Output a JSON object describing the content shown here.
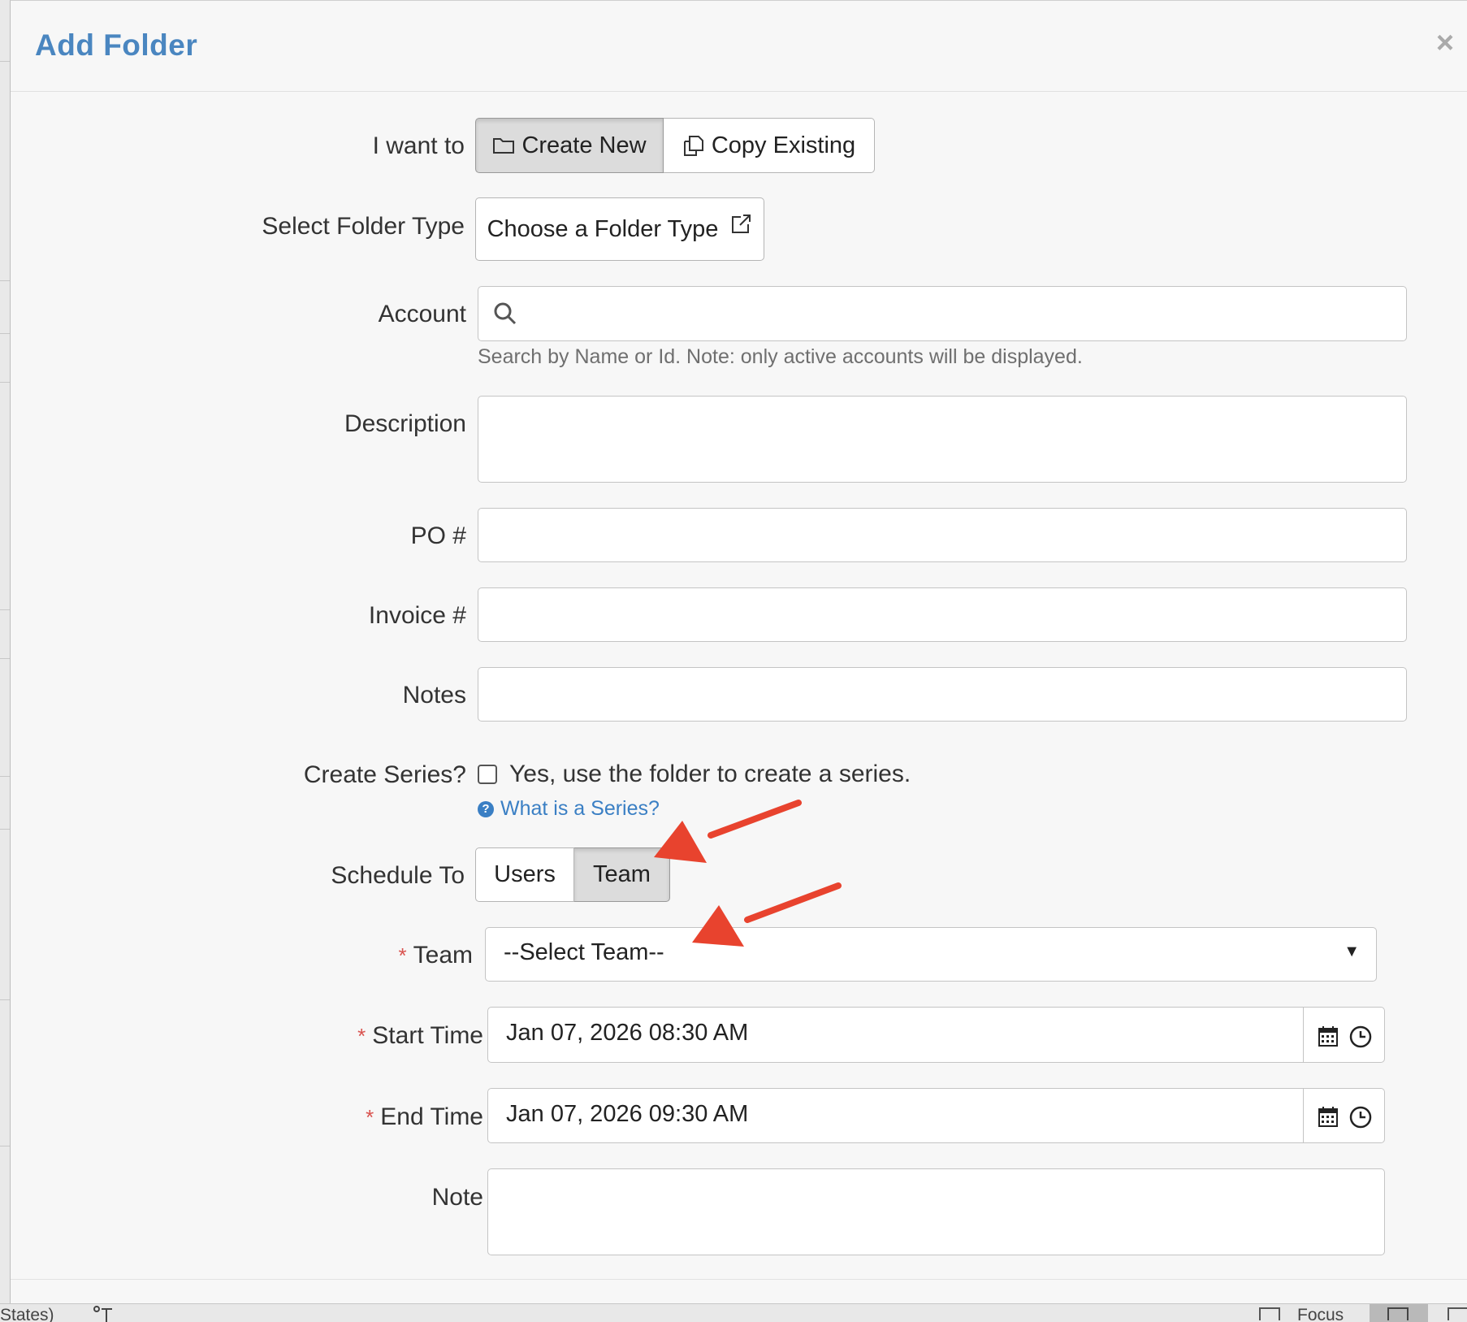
{
  "modal": {
    "title": "Add Folder",
    "close_symbol": "×"
  },
  "form": {
    "i_want_to": {
      "label": "I want to",
      "options": [
        {
          "label": "Create New",
          "icon": "folder-icon",
          "active": true
        },
        {
          "label": "Copy Existing",
          "icon": "copy-icon",
          "active": false
        }
      ]
    },
    "folder_type": {
      "label": "Select Folder Type",
      "button_label": "Choose a Folder Type",
      "icon": "external-link-icon"
    },
    "account": {
      "label": "Account",
      "value": "",
      "icon": "search-icon",
      "help": "Search by Name or Id. Note: only active accounts will be displayed."
    },
    "description": {
      "label": "Description",
      "value": ""
    },
    "po": {
      "label": "PO #",
      "value": ""
    },
    "invoice": {
      "label": "Invoice #",
      "value": ""
    },
    "notes": {
      "label": "Notes",
      "value": ""
    },
    "create_series": {
      "label": "Create Series?",
      "checkbox_label": "Yes, use the folder to create a series.",
      "checked": false,
      "help_link": "What is a Series?"
    },
    "schedule_to": {
      "label": "Schedule To",
      "options": [
        {
          "label": "Users",
          "active": false
        },
        {
          "label": "Team",
          "active": true
        }
      ]
    },
    "team": {
      "required_mark": "*",
      "label": "Team",
      "selected": "--Select Team--"
    },
    "start_time": {
      "required_mark": "*",
      "label": "Start Time",
      "value": "Jan 07, 2026 08:30 AM"
    },
    "end_time": {
      "required_mark": "*",
      "label": "End Time",
      "value": "Jan 07, 2026 09:30 AM"
    },
    "note": {
      "label": "Note",
      "value": ""
    }
  },
  "background": {
    "bottom_left_text": "States)",
    "bottom_right_text": "Focus"
  },
  "colors": {
    "title": "#4a86c0",
    "link": "#3a7fc4",
    "required": "#d9534f",
    "annotation_arrow": "#e8432e"
  }
}
